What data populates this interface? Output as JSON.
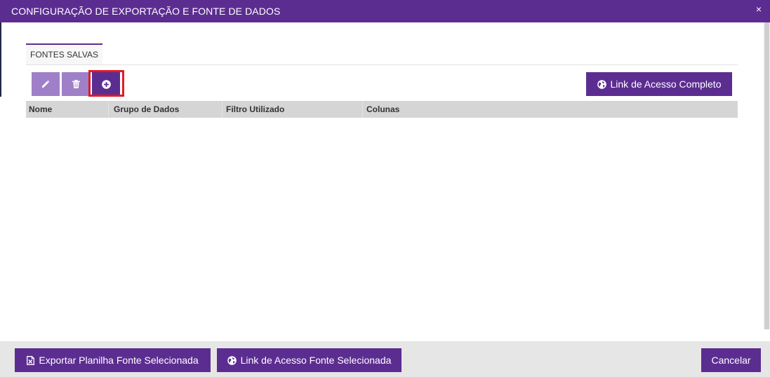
{
  "window": {
    "title": "CONFIGURAÇÃO DE EXPORTAÇÃO E FONTE DE DADOS",
    "close_glyph": "×"
  },
  "tabs": [
    {
      "label": "FONTES SALVAS",
      "active": true
    }
  ],
  "toolbar": {
    "edit_icon": "pencil-icon",
    "delete_icon": "trash-icon",
    "add_icon": "plus-circle-icon",
    "full_link_label": "Link de Acesso Completo",
    "full_link_icon": "globe-icon"
  },
  "table": {
    "columns": [
      "Nome",
      "Grupo de Dados",
      "Filtro Utilizado",
      "Colunas"
    ],
    "rows": []
  },
  "footer": {
    "export_label": "Exportar Planilha Fonte Selecionada",
    "export_icon": "spreadsheet-icon",
    "link_selected_label": "Link de Acesso Fonte Selecionada",
    "link_selected_icon": "globe-icon",
    "cancel_label": "Cancelar"
  },
  "colors": {
    "primary": "#5c2d91",
    "primary_light": "#9f80c8",
    "highlight": "#e21b23",
    "table_header": "#d5d5d5",
    "footer_bg": "#e6e6e6"
  }
}
